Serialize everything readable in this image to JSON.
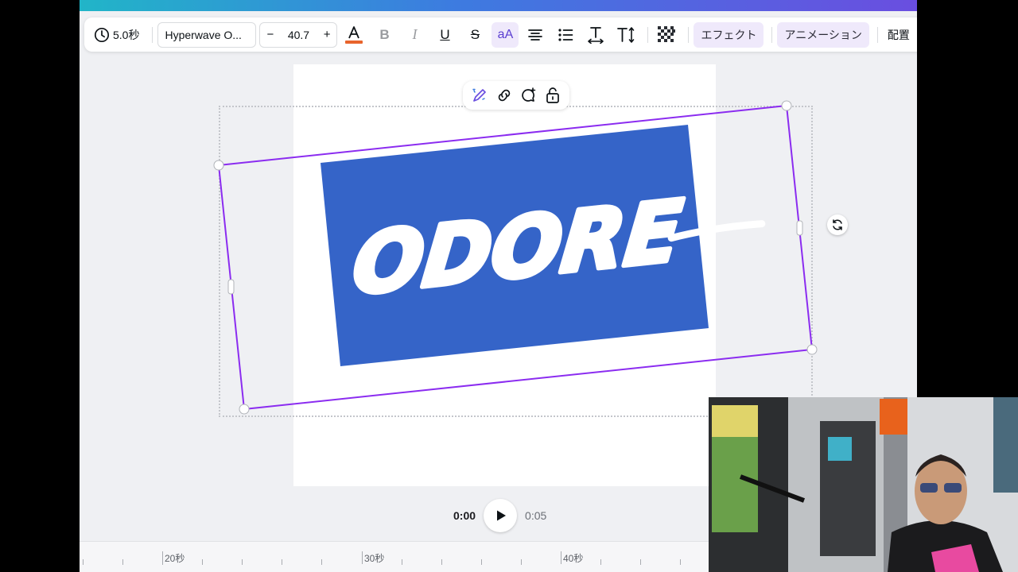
{
  "toolbar": {
    "duration": "5.0秒",
    "font_name": "Hyperwave O...",
    "font_size": "40.7",
    "decrease": "−",
    "increase": "+",
    "bold": "B",
    "italic": "I",
    "underline": "U",
    "strike": "S",
    "case": "aA",
    "effects": "エフェクト",
    "animation": "アニメーション",
    "position": "配置",
    "text_color": "#e8642c"
  },
  "canvas": {
    "logo_text": "ODORE",
    "logo_bg_color": "#3564c8",
    "selection_color": "#8b2cf0"
  },
  "playback": {
    "current_time": "0:00",
    "total_time": "0:05"
  },
  "timeline": {
    "labels": [
      "20秒",
      "30秒",
      "40秒"
    ]
  },
  "icons": {
    "duration": "clock-icon",
    "text_color": "text-color-icon",
    "align": "align-center-icon",
    "list": "bullet-list-icon",
    "spacing": "letter-spacing-icon",
    "vertical": "vertical-text-icon",
    "transparency": "transparency-icon",
    "magic_edit": "magic-pencil-icon",
    "link": "link-icon",
    "comment": "comment-add-icon",
    "lock": "lock-icon",
    "rotate": "rotate-icon",
    "play": "play-icon"
  }
}
